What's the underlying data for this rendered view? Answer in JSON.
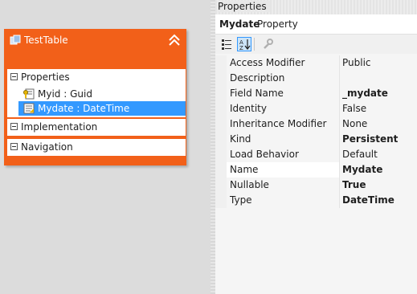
{
  "designer": {
    "entity": {
      "title": "TestTable",
      "sections": {
        "properties": {
          "label": "Properties",
          "items": [
            {
              "label": "Myid : Guid"
            },
            {
              "label": "Mydate : DateTime",
              "selected": true
            }
          ]
        },
        "implementation": {
          "label": "Implementation"
        },
        "navigation": {
          "label": "Navigation"
        }
      }
    }
  },
  "properties_panel": {
    "title": "Properties",
    "subject_name": "Mydate",
    "subject_type": "Property",
    "toolbar": [
      "categorized-icon",
      "alphabetical-icon",
      "wrench-icon"
    ],
    "rows": [
      {
        "name": "Access Modifier",
        "value": "Public",
        "bold": false
      },
      {
        "name": "Description",
        "value": "",
        "bold": false
      },
      {
        "name": "Field Name",
        "value": "_mydate",
        "bold": true
      },
      {
        "name": "Identity",
        "value": "False",
        "bold": false
      },
      {
        "name": "Inheritance Modifier",
        "value": "None",
        "bold": false
      },
      {
        "name": "Kind",
        "value": "Persistent",
        "bold": true
      },
      {
        "name": "Load Behavior",
        "value": "Default",
        "bold": false
      },
      {
        "name": "Name",
        "value": "Mydate",
        "bold": true,
        "selected": true
      },
      {
        "name": "Nullable",
        "value": "True",
        "bold": true
      },
      {
        "name": "Type",
        "value": "DateTime",
        "bold": true
      }
    ]
  },
  "colors": {
    "entity_orange": "#f26019",
    "selection_blue": "#3399ff"
  }
}
